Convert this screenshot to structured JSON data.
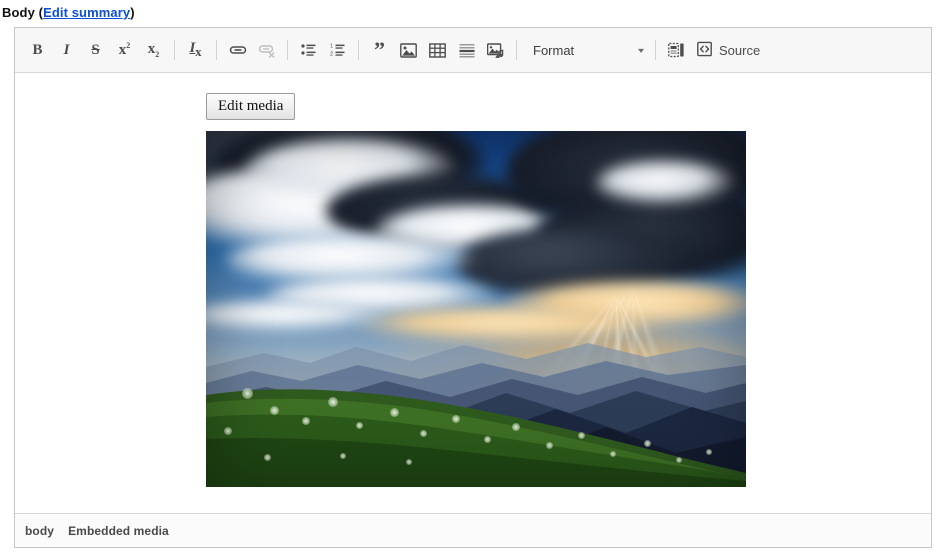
{
  "field": {
    "label": "Body",
    "open_paren": "(",
    "summary_link": "Edit summary",
    "close_paren": ")"
  },
  "toolbar": {
    "groups": [
      {
        "name": "basic-styles",
        "buttons": [
          {
            "name": "bold",
            "label": "B",
            "title": "Bold",
            "disabled": false
          },
          {
            "name": "italic",
            "label": "I",
            "title": "Italic",
            "disabled": false
          },
          {
            "name": "strikethrough",
            "label": "S",
            "title": "Strikethrough",
            "disabled": false
          },
          {
            "name": "superscript",
            "label": "x",
            "sup": "2",
            "title": "Superscript",
            "disabled": false
          },
          {
            "name": "subscript",
            "label": "x",
            "sub": "2",
            "title": "Subscript",
            "disabled": false
          }
        ]
      },
      {
        "name": "remove-format",
        "buttons": [
          {
            "name": "remove-format",
            "label": "I",
            "sub": "x",
            "title": "Remove Format",
            "disabled": false
          }
        ]
      },
      {
        "name": "links",
        "buttons": [
          {
            "name": "link",
            "title": "Link",
            "disabled": false
          },
          {
            "name": "unlink",
            "title": "Unlink",
            "disabled": true
          }
        ]
      },
      {
        "name": "lists",
        "buttons": [
          {
            "name": "bulleted-list",
            "title": "Insert/Remove Bulleted List",
            "disabled": false
          },
          {
            "name": "numbered-list",
            "title": "Insert/Remove Numbered List",
            "disabled": false
          }
        ]
      },
      {
        "name": "insert",
        "buttons": [
          {
            "name": "blockquote",
            "title": "Block Quote",
            "disabled": false
          },
          {
            "name": "image",
            "title": "Image",
            "disabled": false
          },
          {
            "name": "table",
            "title": "Table",
            "disabled": false
          },
          {
            "name": "horizontal-rule",
            "title": "Horizontal Line",
            "disabled": false
          },
          {
            "name": "media",
            "title": "Media",
            "disabled": false
          }
        ]
      }
    ],
    "format_select": {
      "label": "Format",
      "caret": "▾"
    },
    "templates_label": "Templates",
    "source_label": "Source"
  },
  "content": {
    "edit_media_button": "Edit media",
    "media": {
      "type": "image",
      "alt": "Sunbeams breaking through storm clouds over mountain ridges with a green flowering meadow in the foreground"
    }
  },
  "statusbar": {
    "path": [
      "body",
      "Embedded media"
    ]
  },
  "colors": {
    "link": "#0b4fd6",
    "toolbar_bg": "#f7f7f7",
    "border": "#c6c6c6",
    "icon": "#4d4d4d",
    "status_text": "#4a4a4a"
  }
}
